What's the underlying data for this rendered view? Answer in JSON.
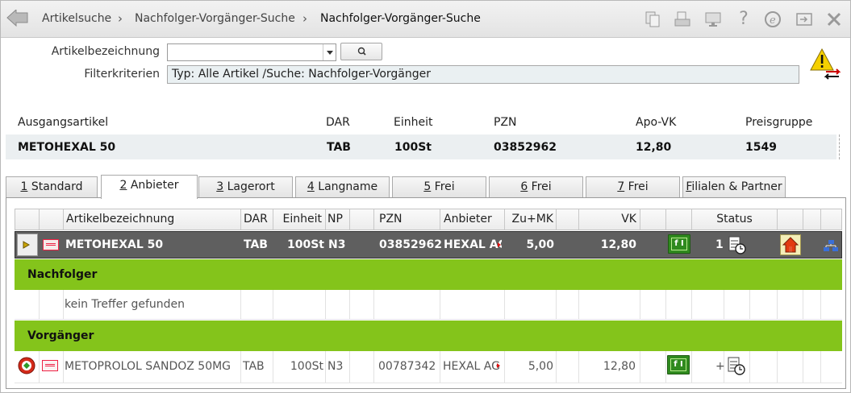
{
  "breadcrumb": [
    "Artikelsuche",
    "Nachfolger-Vorgänger-Suche",
    "Nachfolger-Vorgänger-Suche"
  ],
  "toolbar_icons": [
    "copy-icon",
    "printer-icon",
    "monitor-icon",
    "help-icon",
    "edit-e-icon",
    "export-icon",
    "close-icon"
  ],
  "form": {
    "article_label": "Artikelbezeichnung",
    "article_value": "",
    "filter_label": "Filterkriterien",
    "filter_value": "Typ: Alle Artikel /Suche: Nachfolger-Vorgänger"
  },
  "source_article": {
    "headers": {
      "name": "Ausgangsartikel",
      "dar": "DAR",
      "unit": "Einheit",
      "pzn": "PZN",
      "price": "Apo-VK",
      "group": "Preisgruppe"
    },
    "values": {
      "name": "METOHEXAL 50",
      "dar": "TAB",
      "unit": "100St",
      "pzn": "03852962",
      "price": "12,80",
      "group": "1549"
    }
  },
  "tabs": [
    {
      "key": "1",
      "rest": " Standard"
    },
    {
      "key": "2",
      "rest": " Anbieter"
    },
    {
      "key": "3",
      "rest": " Lagerort"
    },
    {
      "key": "4",
      "rest": " Langname"
    },
    {
      "key": "5",
      "rest": " Frei"
    },
    {
      "key": "6",
      "rest": " Frei"
    },
    {
      "key": "7",
      "rest": " Frei"
    },
    {
      "key": "F",
      "rest": "ilialen & Partner"
    }
  ],
  "active_tab": 1,
  "table": {
    "headers": {
      "name": "Artikelbezeichnung",
      "dar": "DAR",
      "unit": "Einheit",
      "np": "NP",
      "pzn": "PZN",
      "supplier": "Anbieter",
      "zumk": "Zu+MK",
      "vk": "VK",
      "status": "Status"
    },
    "selected": {
      "name": "METOHEXAL 50",
      "dar": "TAB",
      "unit": "100St",
      "np": "N3",
      "pzn": "03852962",
      "supplier": "HEXAL AG",
      "zumk": "5,00",
      "vk": "12,80",
      "status_count": "1"
    },
    "successor_label": "Nachfolger",
    "no_result": "kein Treffer gefunden",
    "predecessor_label": "Vorgänger",
    "predecessor": {
      "name": "METOPROLOL SANDOZ 50MG",
      "dar": "TAB",
      "unit": "100St",
      "np": "N3",
      "pzn": "00787342",
      "supplier": "HEXAL AG",
      "zumk": "5,00",
      "vk": "12,80",
      "status_count": "+"
    },
    "price_badge": "f I"
  },
  "colors": {
    "accent_green": "#84c41b",
    "selected_row": "#5f5f5f",
    "warning": "#f5d000"
  }
}
